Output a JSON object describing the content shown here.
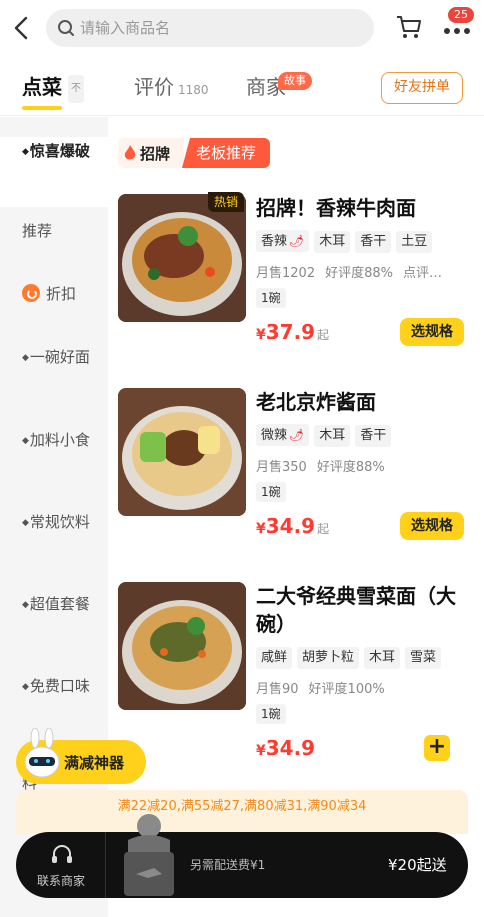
{
  "search": {
    "placeholder": "请输入商品名"
  },
  "header": {
    "more_badge": "25"
  },
  "tabs": [
    {
      "label": "点菜",
      "extra": "不"
    },
    {
      "label": "评价",
      "count": "1180"
    },
    {
      "label": "商家",
      "badge": "故事"
    }
  ],
  "group_order_label": "好友拼单",
  "sidebar": {
    "items": [
      {
        "label": "惊喜爆破",
        "dot": "◆"
      },
      {
        "label": "推荐"
      },
      {
        "label": "折扣"
      },
      {
        "label": "一碗好面",
        "dot": "◆"
      },
      {
        "label": "加料小食",
        "dot": "◆"
      },
      {
        "label": "常规饮料",
        "dot": "◆"
      },
      {
        "label": "超值套餐",
        "dot": "◆"
      },
      {
        "label": "免费口味",
        "dot": "◆"
      }
    ],
    "peek": "料"
  },
  "section": {
    "signature": "招牌",
    "boss": "老板推荐"
  },
  "dishes": [
    {
      "name": "招牌！香辣牛肉面",
      "hot": "热销",
      "tags": [
        "香辣",
        "木耳",
        "香干",
        "土豆"
      ],
      "sales": "月售1202",
      "rating": "好评度88%",
      "extra": "点评…",
      "unit": "1碗",
      "price": "37.9",
      "price_suffix": "起",
      "action": "选规格"
    },
    {
      "name": "老北京炸酱面",
      "tags": [
        "微辣",
        "木耳",
        "香干"
      ],
      "sales": "月售350",
      "rating": "好评度88%",
      "unit": "1碗",
      "price": "34.9",
      "price_suffix": "起",
      "action": "选规格"
    },
    {
      "name": "二大爷经典雪菜面（大碗）",
      "tags": [
        "咸鲜",
        "胡萝卜粒",
        "木耳",
        "雪菜"
      ],
      "sales": "月售90",
      "rating": "好评度100%",
      "unit": "1碗",
      "price": "34.9",
      "action": "+"
    }
  ],
  "currency": "¥",
  "reduce_chip": "满减神器",
  "promo": "满22减20,满55减27,满80减31,满90减34",
  "bottom": {
    "contact": "联系商家",
    "fee": "另需配送费¥1",
    "min_order": "¥20起送"
  },
  "colors": {
    "accent": "#ffd11a",
    "price": "#ff3b30",
    "signature": "#ff5a3c"
  }
}
